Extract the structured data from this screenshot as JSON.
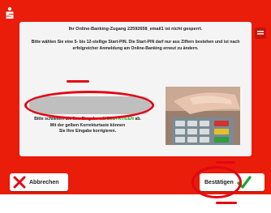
{
  "colors": {
    "brand_red": "#ea1c0a",
    "annotation_red": "#e30613",
    "panel_bg": "#f4f4f4",
    "input_bg": "#bfbfbf",
    "confirm_green": "#1aa62a",
    "cancel_red": "#e30613"
  },
  "header": {
    "logo_icon": "sparkasse-s-logo-icon",
    "corner_icon": "language-icon"
  },
  "message": {
    "title": "Ihr Online-Banking-Zugang 22592658_email1 ist nicht gesperrt.",
    "body": "Bitte wählen Sie eine 5- bis 12-stellige Start-PIN. Die Start-PIN darf nur aus Ziffern bestehen und ist nach erfolgreicher Anmeldung am Online-Banking erneut zu ändern."
  },
  "pin_input": {
    "value": ""
  },
  "hint": {
    "line1": "Bitte schließen Sie Ihre Eingabe mit",
    "green_key": "BESTÄTIGEN",
    "line1_end": "ab.",
    "line2": "Mit der gelben Korrekturtaste können",
    "line3": "Sie Ihre Eingabe korrigieren."
  },
  "buttons": {
    "cancel_label": "Abbrechen",
    "cancel_icon": "x-icon",
    "confirm_label": "Bestätigen",
    "confirm_icon": "checkmark-icon"
  }
}
